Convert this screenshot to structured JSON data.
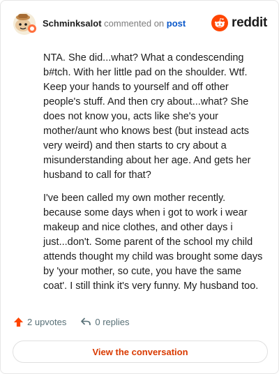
{
  "header": {
    "username": "Schminksalot",
    "verb": "commented on",
    "post_link": "post",
    "brand": "reddit"
  },
  "comment": {
    "paragraphs": [
      "NTA. She did...what? What a condescending b#tch. With her little pad on the shoulder. Wtf. Keep your hands to yourself and off other people's stuff. And then cry about...what? She does not know you, acts like she's your mother/aunt who knows best (but instead acts very weird) and then starts to cry about a misunderstanding about her age. And gets her husband to call for that?",
      "I've been called my own mother recently. because some days when i got to work i wear makeup and nice clothes, and other days i just...don't. Some parent of the school my child attends thought my child was brought some days by 'your mother, so cute, you have the same coat'. I still think it's very funny. My husband too."
    ]
  },
  "actions": {
    "upvotes": "2 upvotes",
    "replies": "0 replies"
  },
  "view_button": "View the conversation",
  "icons": {
    "avatar": "snoo-avatar-icon",
    "brand": "reddit-logo-icon",
    "upvote": "upvote-arrow-icon",
    "reply": "reply-arrow-icon"
  },
  "colors": {
    "accent": "#d93a00",
    "brand_orange": "#ff4500",
    "link": "#0a58ca",
    "muted": "#576f76"
  }
}
